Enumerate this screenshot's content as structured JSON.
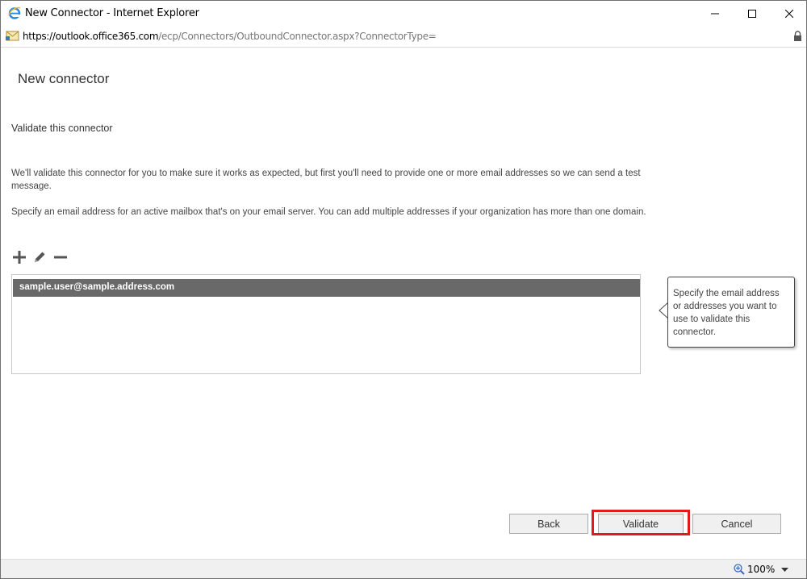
{
  "window": {
    "title": "New Connector - Internet Explorer",
    "icon": "internet-explorer-icon"
  },
  "address_bar": {
    "url_prefix": "https://outlook.",
    "url_domain": "office365.com",
    "url_path": "/ecp/Connectors/OutboundConnector.aspx?ConnectorType="
  },
  "page": {
    "title": "New connector",
    "section_title": "Validate this connector",
    "description": "We'll validate this connector for you to make sure it works as expected, but first you'll need to provide one or more email addresses so we can send a test message.",
    "instruction": "Specify an email address for an active mailbox that's on your email server. You can add multiple addresses if your organization has more than one domain."
  },
  "toolbar": {
    "add_icon": "plus-icon",
    "edit_icon": "pencil-icon",
    "remove_icon": "minus-icon"
  },
  "email_list": {
    "items": [
      {
        "email": "sample.user@sample.address.com",
        "selected": true
      }
    ]
  },
  "callout": {
    "text": "Specify the email address or addresses you want to use to validate this connector."
  },
  "buttons": {
    "back": "Back",
    "validate": "Validate",
    "cancel": "Cancel"
  },
  "status_bar": {
    "zoom": "100%"
  },
  "colors": {
    "selected_row": "#696969",
    "highlight_border": "#e01b1b",
    "button_bg": "#f0f0f0"
  }
}
